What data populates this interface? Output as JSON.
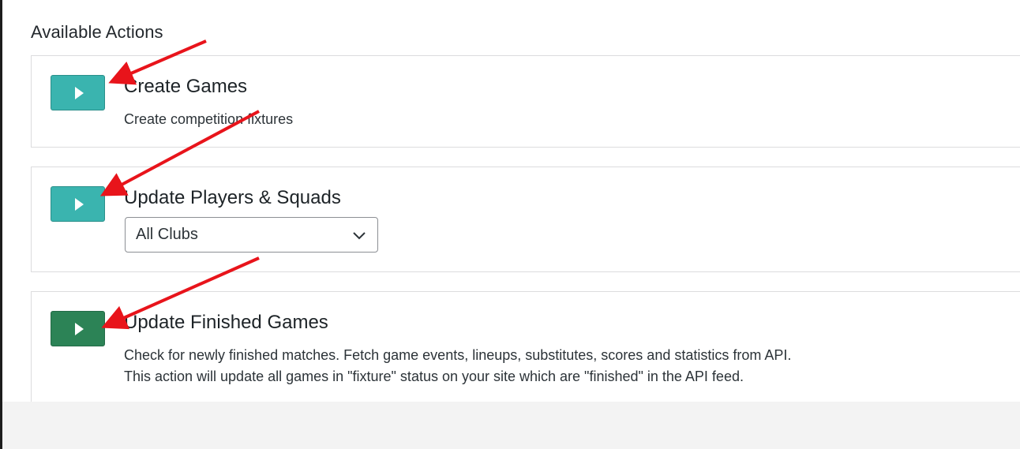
{
  "section": {
    "title": "Available Actions"
  },
  "actions": [
    {
      "title": "Create Games",
      "description": "Create competition fixtures",
      "button_color": "#3ab4af"
    },
    {
      "title": "Update Players & Squads",
      "select_value": "All Clubs",
      "button_color": "#3ab4af"
    },
    {
      "title": "Update Finished Games",
      "description_line1": "Check for newly finished matches. Fetch game events, lineups, substitutes, scores and statistics from API.",
      "description_line2": "This action will update all games in \"fixture\" status on your site which are \"finished\" in the API feed.",
      "button_color": "#2c8356"
    }
  ],
  "icons": {
    "run": "play-icon",
    "dropdown": "chevron-down-icon",
    "annotation": "red-arrow"
  },
  "colors": {
    "annotation_arrow": "#e8141b",
    "footer_background": "#f3f3f3"
  }
}
